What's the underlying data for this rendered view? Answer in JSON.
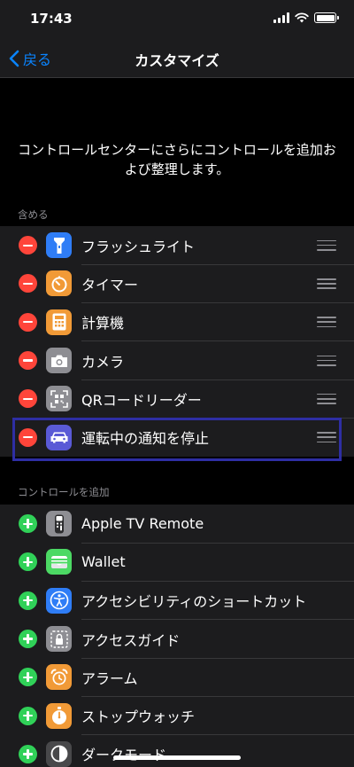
{
  "status_bar": {
    "time": "17:43"
  },
  "nav": {
    "back_label": "戻る",
    "title": "カスタマイズ"
  },
  "description": "コントロールセンターにさらにコントロールを追加および整理します。",
  "included": {
    "header": "含める",
    "items": [
      {
        "label": "フラッシュライト",
        "icon": "flashlight-icon",
        "color": "#2f7df6"
      },
      {
        "label": "タイマー",
        "icon": "timer-icon",
        "color": "#f19a37"
      },
      {
        "label": "計算機",
        "icon": "calculator-icon",
        "color": "#f19a37"
      },
      {
        "label": "カメラ",
        "icon": "camera-icon",
        "color": "#8e8e93"
      },
      {
        "label": "QRコードリーダー",
        "icon": "qr-code-icon",
        "color": "#8e8e93"
      },
      {
        "label": "運転中の通知を停止",
        "icon": "car-icon",
        "color": "#5a5ad6"
      }
    ]
  },
  "more": {
    "header": "コントロールを追加",
    "items": [
      {
        "label": "Apple TV Remote",
        "icon": "tv-remote-icon",
        "color": "#8e8e93"
      },
      {
        "label": "Wallet",
        "icon": "wallet-icon",
        "color": "#4cd964"
      },
      {
        "label": "アクセシビリティのショートカット",
        "icon": "accessibility-icon",
        "color": "#2f7df6"
      },
      {
        "label": "アクセスガイド",
        "icon": "lock-icon",
        "color": "#8e8e93"
      },
      {
        "label": "アラーム",
        "icon": "alarm-icon",
        "color": "#f19a37"
      },
      {
        "label": "ストップウォッチ",
        "icon": "stopwatch-icon",
        "color": "#f19a37"
      },
      {
        "label": "ダークモード",
        "icon": "dark-mode-icon",
        "color": "#48484a"
      }
    ]
  },
  "colors": {
    "accent": "#0a84ff",
    "remove": "#ff453a",
    "add": "#30d158",
    "highlight": "#2e2ea3"
  }
}
